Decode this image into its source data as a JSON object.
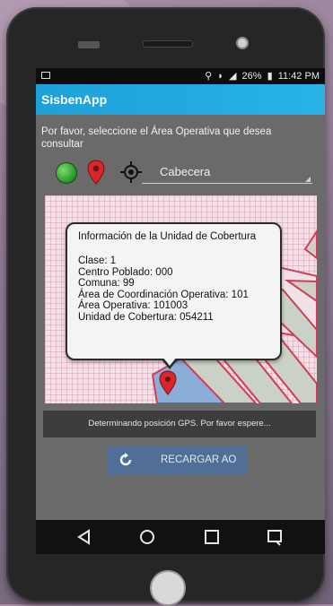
{
  "statusbar": {
    "signal": "■",
    "battery_percent": "26%",
    "battery_icon": "battery-icon",
    "time": "11:42 PM"
  },
  "app": {
    "title": "SisbenApp"
  },
  "prompt_text": "Por favor, seleccione el Área Operativa que desea consultar",
  "toolbar": {
    "layers_icon": "green-layer-icon",
    "pin_icon": "location-pin-icon",
    "locate_icon": "gps-target-icon"
  },
  "area_select": {
    "value": "Cabecera"
  },
  "popup": {
    "title": "Información de la Unidad de Cobertura",
    "lines": [
      "Clase: 1",
      "Centro Poblado: 000",
      "Comuna: 99",
      "Área de Coordinación Operativa: 101",
      "Área Operativa: 101003",
      "Unidad de Cobertura: 054211"
    ]
  },
  "gps_message": "Determinando posición GPS. Por favor espere...",
  "reload_button": {
    "label": "RECARGAR AO"
  },
  "navbar": [
    "back-icon",
    "home-icon",
    "recents-icon",
    "menu-icon"
  ],
  "colors": {
    "appbar": "#1ea1d8",
    "map_border": "#d23c5a",
    "map_fill_blue": "#8aaed8",
    "pin": "#d8262b",
    "button": "#4f6f97"
  }
}
